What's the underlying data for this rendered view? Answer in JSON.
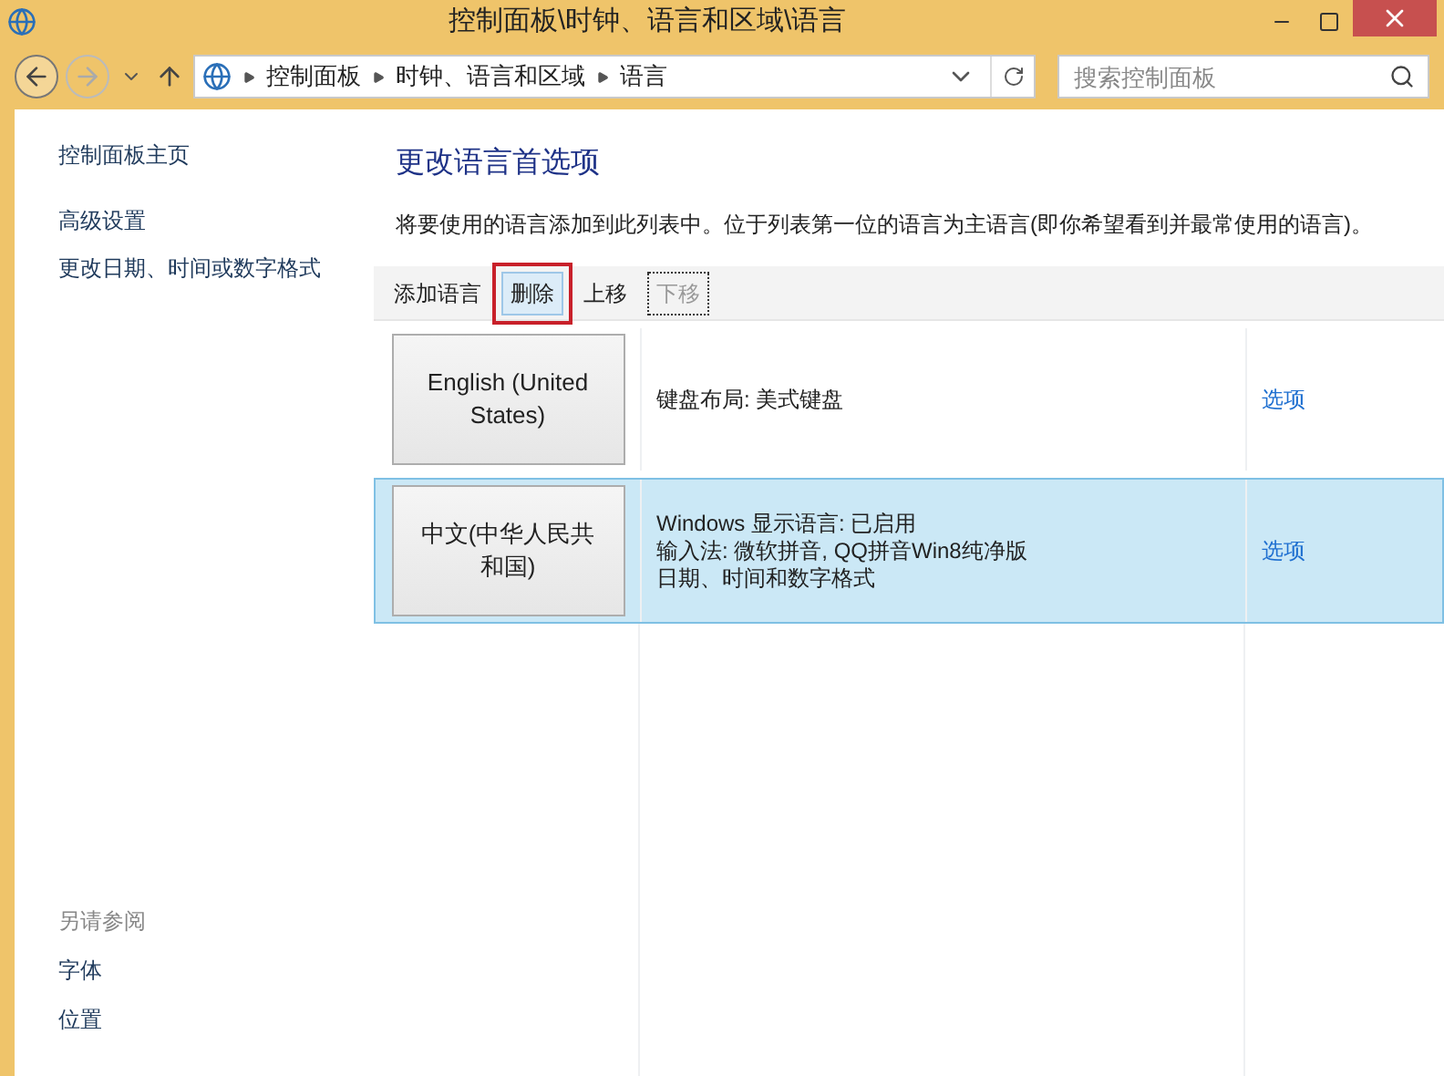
{
  "window": {
    "title": "控制面板\\时钟、语言和区域\\语言"
  },
  "address_bar": {
    "crumbs": [
      "控制面板",
      "时钟、语言和区域",
      "语言"
    ]
  },
  "search": {
    "placeholder": "搜索控制面板"
  },
  "sidebar": {
    "items": [
      "控制面板主页",
      "高级设置",
      "更改日期、时间或数字格式"
    ],
    "see_also_title": "另请参阅",
    "see_also": [
      "字体",
      "位置"
    ]
  },
  "heading": "更改语言首选项",
  "description": "将要使用的语言添加到此列表中。位于列表第一位的语言为主语言(即你希望看到并最常使用的语言)。",
  "toolbar": [
    {
      "label": "添加语言",
      "disabled": false,
      "hovered": false,
      "focused": false
    },
    {
      "label": "删除",
      "disabled": false,
      "hovered": true,
      "focused": false
    },
    {
      "label": "上移",
      "disabled": false,
      "hovered": false,
      "focused": false
    },
    {
      "label": "下移",
      "disabled": true,
      "hovered": false,
      "focused": true
    }
  ],
  "languages": [
    {
      "name": "English (United States)",
      "details": [
        "键盘布局: 美式键盘"
      ],
      "options": "选项",
      "selected": false
    },
    {
      "name": "中文(中华人民共和国)",
      "details": [
        "Windows 显示语言: 已启用",
        "输入法: 微软拼音, QQ拼音Win8纯净版",
        "日期、时间和数字格式"
      ],
      "options": "选项",
      "selected": true
    }
  ]
}
